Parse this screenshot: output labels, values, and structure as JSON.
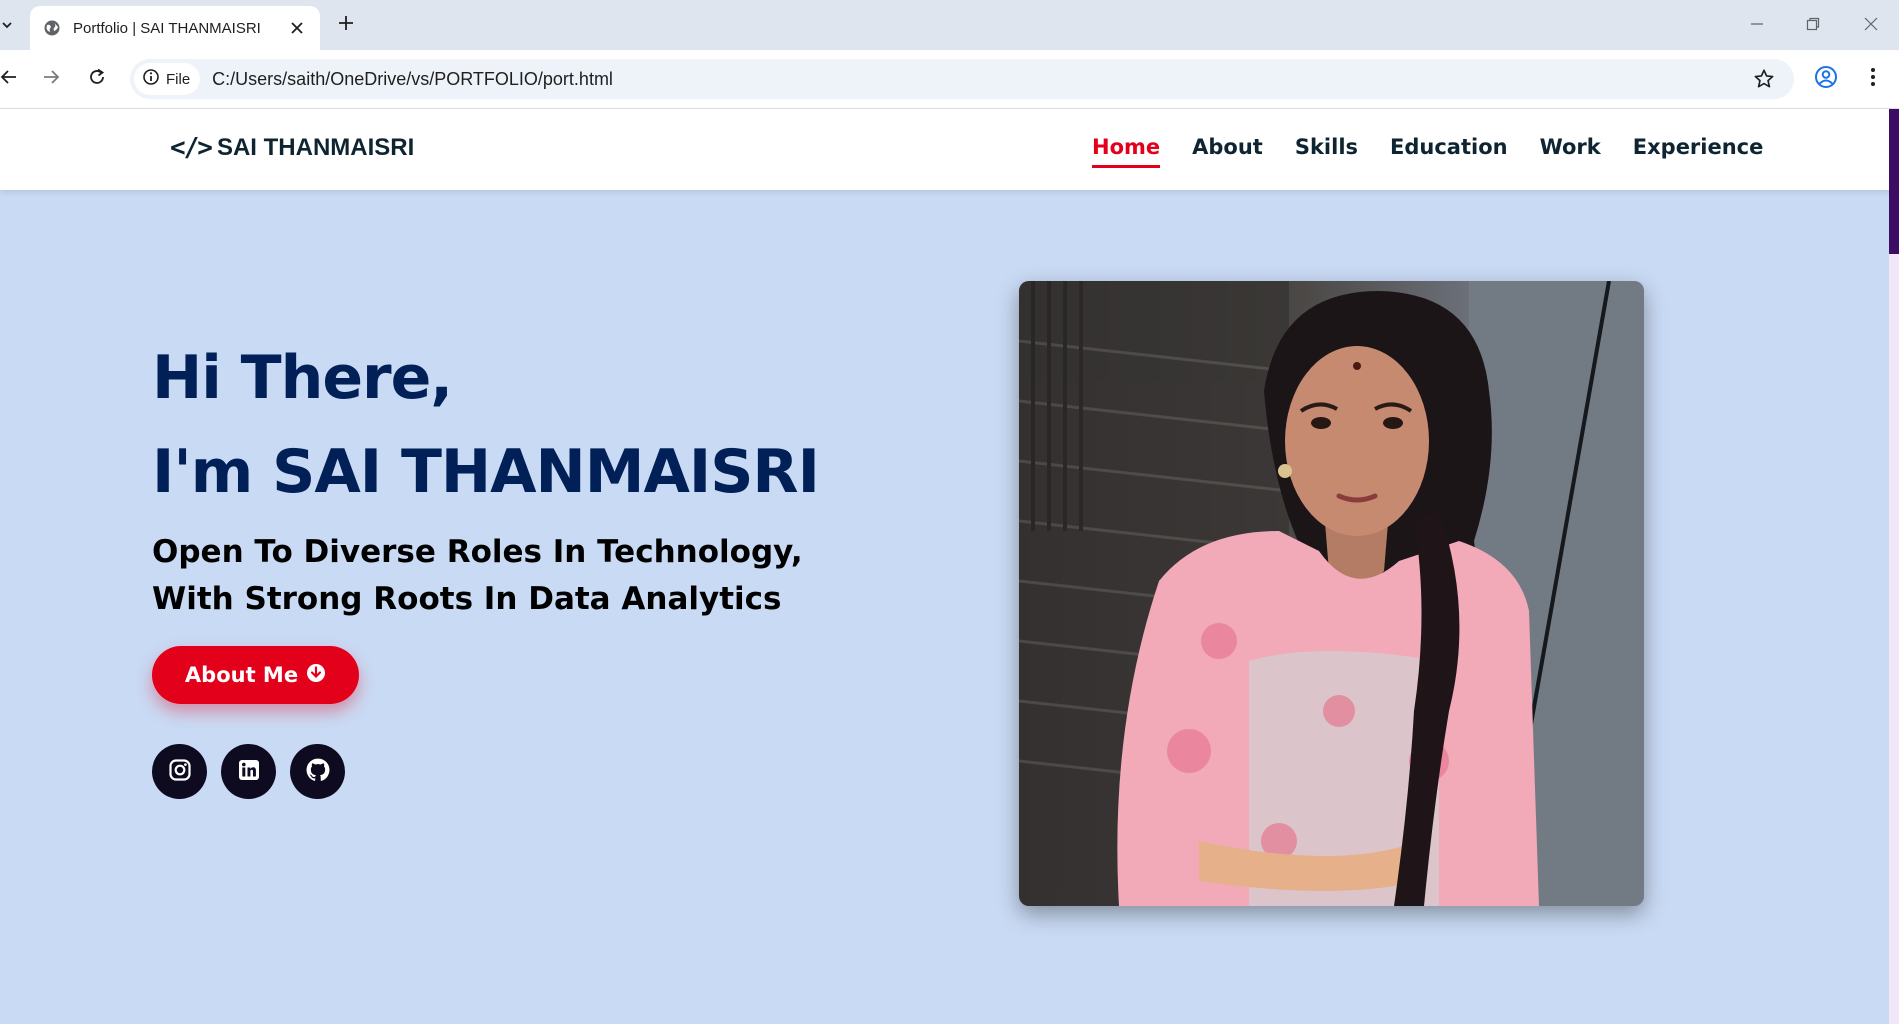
{
  "browser": {
    "tab_title": "Portfolio | SAI THANMAISRI",
    "chip_label": "File",
    "url": "C:/Users/saith/OneDrive/vs/PORTFOLIO/port.html"
  },
  "site": {
    "brand_code": "</>",
    "brand_name": "SAI THANMAISRI",
    "nav": [
      "Home",
      "About",
      "Skills",
      "Education",
      "Work",
      "Experience"
    ],
    "active_nav": "Home"
  },
  "hero": {
    "greeting": "Hi There,",
    "intro": "I'm SAI THANMAISRI",
    "tagline": "Open To Diverse Roles In Technology, With Strong Roots In Data Analytics",
    "button_label": "About Me",
    "socials": [
      "instagram-icon",
      "linkedin-icon",
      "github-icon"
    ]
  },
  "colors": {
    "accent": "#e2001a",
    "heading": "#002057",
    "hero_bg": "#c9daf4",
    "social_bg": "#0e0a1f"
  }
}
